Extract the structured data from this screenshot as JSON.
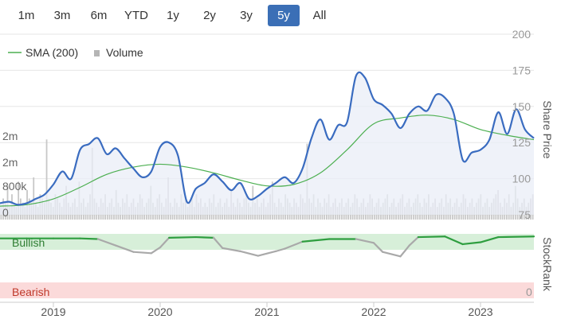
{
  "range_selector": {
    "buttons": [
      "1m",
      "3m",
      "6m",
      "YTD",
      "1y",
      "2y",
      "3y",
      "5y",
      "All"
    ],
    "active": "5y"
  },
  "legend": {
    "sma_label": "SMA (200)",
    "volume_label": "Volume"
  },
  "axes": {
    "price_title": "Share Price",
    "rank_title": "StockRank",
    "price_ticks": [
      "200",
      "175",
      "150",
      "125",
      "100",
      "75"
    ],
    "volume_ticks": [
      "2m",
      "2m",
      "800k",
      "0"
    ],
    "rank_ticks": [
      "0"
    ],
    "x_ticks": [
      "2019",
      "2020",
      "2021",
      "2022",
      "2023"
    ]
  },
  "bands": {
    "bullish": "Bullish",
    "bearish": "Bearish"
  },
  "colors": {
    "price_line": "#3a6cc0",
    "price_fill": "#e9edf7",
    "sma_line": "#4caf50",
    "volume_bar": "#c8c8c8",
    "bullish_band": "#d7efd9",
    "bearish_band": "#fbdada",
    "rank_bullish": "#2e9e3f",
    "rank_neutral": "#a9a9a9",
    "active_button": "#3b6fb6"
  },
  "chart_data": {
    "type": "line",
    "price_ylim": [
      75,
      200
    ],
    "x_start": "2018-07",
    "x_end": "2023-07",
    "price_series": [
      {
        "x": "2018-07",
        "y": 83
      },
      {
        "x": "2018-08",
        "y": 84
      },
      {
        "x": "2018-09",
        "y": 82
      },
      {
        "x": "2018-10",
        "y": 83
      },
      {
        "x": "2018-11",
        "y": 86
      },
      {
        "x": "2018-12",
        "y": 89
      },
      {
        "x": "2019-01",
        "y": 96
      },
      {
        "x": "2019-02",
        "y": 105
      },
      {
        "x": "2019-03",
        "y": 100
      },
      {
        "x": "2019-04",
        "y": 120
      },
      {
        "x": "2019-05",
        "y": 124
      },
      {
        "x": "2019-06",
        "y": 128
      },
      {
        "x": "2019-07",
        "y": 117
      },
      {
        "x": "2019-08",
        "y": 121
      },
      {
        "x": "2019-09",
        "y": 114
      },
      {
        "x": "2019-10",
        "y": 107
      },
      {
        "x": "2019-11",
        "y": 101
      },
      {
        "x": "2019-12",
        "y": 105
      },
      {
        "x": "2020-01",
        "y": 122
      },
      {
        "x": "2020-02",
        "y": 125
      },
      {
        "x": "2020-03",
        "y": 116
      },
      {
        "x": "2020-04",
        "y": 84
      },
      {
        "x": "2020-05",
        "y": 93
      },
      {
        "x": "2020-06",
        "y": 97
      },
      {
        "x": "2020-07",
        "y": 103
      },
      {
        "x": "2020-08",
        "y": 98
      },
      {
        "x": "2020-09",
        "y": 92
      },
      {
        "x": "2020-10",
        "y": 97
      },
      {
        "x": "2020-11",
        "y": 86
      },
      {
        "x": "2020-12",
        "y": 88
      },
      {
        "x": "2021-01",
        "y": 93
      },
      {
        "x": "2021-02",
        "y": 97
      },
      {
        "x": "2021-03",
        "y": 101
      },
      {
        "x": "2021-04",
        "y": 97
      },
      {
        "x": "2021-05",
        "y": 107
      },
      {
        "x": "2021-06",
        "y": 128
      },
      {
        "x": "2021-07",
        "y": 141
      },
      {
        "x": "2021-08",
        "y": 127
      },
      {
        "x": "2021-09",
        "y": 137
      },
      {
        "x": "2021-10",
        "y": 139
      },
      {
        "x": "2021-11",
        "y": 171
      },
      {
        "x": "2021-12",
        "y": 170
      },
      {
        "x": "2022-01",
        "y": 155
      },
      {
        "x": "2022-02",
        "y": 151
      },
      {
        "x": "2022-03",
        "y": 145
      },
      {
        "x": "2022-04",
        "y": 135
      },
      {
        "x": "2022-05",
        "y": 145
      },
      {
        "x": "2022-06",
        "y": 150
      },
      {
        "x": "2022-07",
        "y": 147
      },
      {
        "x": "2022-08",
        "y": 158
      },
      {
        "x": "2022-09",
        "y": 156
      },
      {
        "x": "2022-10",
        "y": 145
      },
      {
        "x": "2022-11",
        "y": 113
      },
      {
        "x": "2022-12",
        "y": 118
      },
      {
        "x": "2023-01",
        "y": 120
      },
      {
        "x": "2023-02",
        "y": 127
      },
      {
        "x": "2023-03",
        "y": 146
      },
      {
        "x": "2023-04",
        "y": 131
      },
      {
        "x": "2023-05",
        "y": 148
      },
      {
        "x": "2023-06",
        "y": 134
      },
      {
        "x": "2023-07",
        "y": 128
      }
    ],
    "sma_series": [
      {
        "x": "2018-07",
        "y": 81
      },
      {
        "x": "2018-10",
        "y": 82
      },
      {
        "x": "2019-01",
        "y": 86
      },
      {
        "x": "2019-04",
        "y": 94
      },
      {
        "x": "2019-07",
        "y": 103
      },
      {
        "x": "2019-10",
        "y": 108
      },
      {
        "x": "2020-01",
        "y": 110
      },
      {
        "x": "2020-04",
        "y": 108
      },
      {
        "x": "2020-07",
        "y": 104
      },
      {
        "x": "2020-10",
        "y": 99
      },
      {
        "x": "2021-01",
        "y": 95
      },
      {
        "x": "2021-04",
        "y": 96
      },
      {
        "x": "2021-07",
        "y": 104
      },
      {
        "x": "2021-10",
        "y": 120
      },
      {
        "x": "2022-01",
        "y": 138
      },
      {
        "x": "2022-04",
        "y": 142
      },
      {
        "x": "2022-07",
        "y": 144
      },
      {
        "x": "2022-10",
        "y": 141
      },
      {
        "x": "2023-01",
        "y": 134
      },
      {
        "x": "2023-04",
        "y": 130
      },
      {
        "x": "2023-07",
        "y": 127
      }
    ],
    "volume_series": [
      0.3,
      0.5,
      0.4,
      0.8,
      0.3,
      0.6,
      0.4,
      0.3,
      0.9,
      0.5,
      0.4,
      0.3,
      0.7,
      0.5,
      0.4,
      1.0,
      0.4,
      0.3,
      0.6,
      0.5,
      0.4,
      1.9,
      0.5,
      0.4,
      0.3,
      0.6,
      0.5,
      0.4,
      0.3,
      0.5,
      0.8,
      0.4,
      0.3,
      0.4,
      0.5,
      0.3,
      0.9,
      0.4,
      0.5,
      0.3,
      0.4,
      0.6,
      1.7,
      0.5,
      0.4,
      0.3,
      0.5,
      0.4,
      0.6,
      0.3,
      0.4,
      0.5,
      0.3,
      0.7,
      0.4,
      0.3,
      0.5,
      0.4,
      0.6,
      0.3,
      0.4,
      0.5,
      0.3,
      0.4,
      0.6,
      0.5,
      0.3,
      0.4,
      0.5,
      0.8,
      0.4,
      0.3,
      0.5,
      0.6,
      0.4,
      0.3,
      0.5,
      1.0,
      0.4,
      0.3,
      0.5,
      0.4,
      0.3,
      0.6,
      0.4,
      0.5,
      0.3,
      0.4,
      0.5,
      0.3,
      0.6,
      0.4,
      0.5,
      0.3,
      0.4,
      0.3,
      0.5,
      0.4,
      0.6,
      0.3,
      0.4,
      0.5,
      0.3,
      0.4,
      0.5,
      0.3,
      0.7,
      0.4,
      0.3,
      0.5,
      0.4,
      0.3,
      0.5,
      0.6,
      0.4,
      0.3,
      0.8,
      0.4,
      0.5,
      0.3,
      0.4,
      0.5,
      0.3,
      0.4,
      0.6,
      0.9,
      0.4,
      0.3,
      0.5,
      0.4,
      0.3,
      0.6,
      0.5,
      0.4,
      0.3,
      0.5,
      0.4,
      0.3,
      0.6,
      0.5,
      0.4,
      1.8,
      0.5,
      0.4,
      0.6,
      0.3,
      0.5,
      0.4,
      0.3,
      0.5,
      0.4,
      0.6,
      0.3,
      0.4,
      0.5,
      0.3,
      0.4,
      0.5,
      0.3,
      0.4,
      0.5,
      0.3,
      0.4,
      0.6,
      0.5,
      0.3,
      0.4,
      0.5,
      0.3,
      0.4,
      0.6,
      0.5,
      0.3,
      0.4,
      0.5,
      0.3,
      0.4,
      0.5,
      0.6,
      0.3,
      0.4,
      0.5,
      0.3,
      0.4,
      0.5,
      0.6,
      0.3,
      0.4,
      0.5,
      0.3,
      0.4,
      0.5,
      0.6,
      0.4,
      0.3,
      0.5,
      0.4,
      0.6,
      0.3,
      0.4,
      0.5,
      0.3,
      0.4,
      0.5,
      0.3,
      0.6,
      0.4,
      0.5,
      0.3,
      0.4,
      0.5,
      0.3,
      0.4,
      0.6,
      0.5,
      0.3,
      0.4,
      0.5,
      0.3,
      0.4,
      0.5,
      0.6,
      0.3,
      0.4,
      0.5,
      0.3,
      0.4,
      0.5,
      0.6,
      0.7,
      0.4,
      0.3,
      0.5,
      0.4,
      0.6,
      0.3,
      0.4,
      0.8,
      0.5,
      0.3,
      0.4,
      0.5,
      0.3,
      0.4,
      0.5,
      0.6
    ],
    "stockrank_series": [
      {
        "x": "2018-07",
        "v": 93,
        "state": "bullish"
      },
      {
        "x": "2018-10",
        "v": 93,
        "state": "bullish"
      },
      {
        "x": "2019-01",
        "v": 93,
        "state": "bullish"
      },
      {
        "x": "2019-04",
        "v": 93,
        "state": "bullish"
      },
      {
        "x": "2019-06",
        "v": 92,
        "state": "bullish"
      },
      {
        "x": "2019-08",
        "v": 82,
        "state": "neutral"
      },
      {
        "x": "2019-10",
        "v": 72,
        "state": "neutral"
      },
      {
        "x": "2019-12",
        "v": 70,
        "state": "neutral"
      },
      {
        "x": "2020-01",
        "v": 79,
        "state": "neutral"
      },
      {
        "x": "2020-02",
        "v": 94,
        "state": "bullish"
      },
      {
        "x": "2020-05",
        "v": 95,
        "state": "bullish"
      },
      {
        "x": "2020-07",
        "v": 94,
        "state": "bullish"
      },
      {
        "x": "2020-08",
        "v": 78,
        "state": "neutral"
      },
      {
        "x": "2020-10",
        "v": 73,
        "state": "neutral"
      },
      {
        "x": "2020-12",
        "v": 66,
        "state": "neutral"
      },
      {
        "x": "2021-02",
        "v": 73,
        "state": "neutral"
      },
      {
        "x": "2021-03",
        "v": 77,
        "state": "neutral"
      },
      {
        "x": "2021-05",
        "v": 88,
        "state": "bullish"
      },
      {
        "x": "2021-08",
        "v": 92,
        "state": "bullish"
      },
      {
        "x": "2021-11",
        "v": 92,
        "state": "bullish"
      },
      {
        "x": "2022-01",
        "v": 86,
        "state": "neutral"
      },
      {
        "x": "2022-02",
        "v": 72,
        "state": "neutral"
      },
      {
        "x": "2022-04",
        "v": 65,
        "state": "neutral"
      },
      {
        "x": "2022-05",
        "v": 82,
        "state": "neutral"
      },
      {
        "x": "2022-06",
        "v": 95,
        "state": "bullish"
      },
      {
        "x": "2022-09",
        "v": 96,
        "state": "bullish"
      },
      {
        "x": "2022-11",
        "v": 84,
        "state": "bullish"
      },
      {
        "x": "2023-01",
        "v": 87,
        "state": "bullish"
      },
      {
        "x": "2023-03",
        "v": 95,
        "state": "bullish"
      },
      {
        "x": "2023-07",
        "v": 96,
        "state": "bullish"
      }
    ]
  }
}
